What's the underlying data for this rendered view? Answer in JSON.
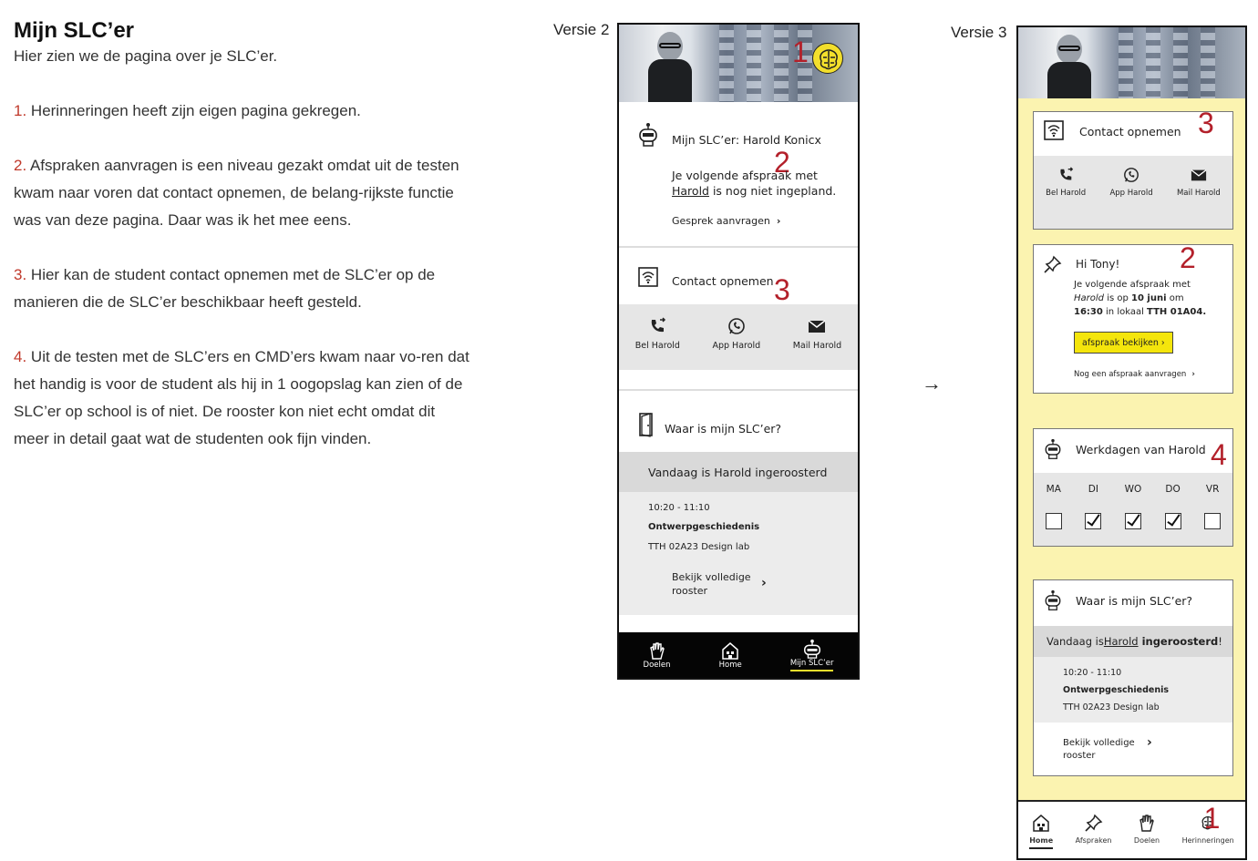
{
  "doc": {
    "title": "Mijn SLC’er",
    "subtitle": "Hier zien we de pagina over je SLC’er.",
    "points": [
      {
        "num": "1.",
        "text": " Herinneringen heeft zijn eigen pagina gekregen."
      },
      {
        "num": "2.",
        "text": " Afspraken aanvragen is een niveau gezakt omdat uit de testen kwam naar voren dat contact opnemen, de belang-rijkste functie was van deze pagina. Daar was ik het mee eens."
      },
      {
        "num": "3.",
        "text": " Hier kan de student contact opnemen met de SLC’er op de manieren die de SLC’er beschikbaar heeft gesteld."
      },
      {
        "num": "4.",
        "text": " Uit de testen met de SLC’ers en CMD’ers kwam naar vo-ren dat het handig is voor de student als hij in 1 oogopslag kan zien of de SLC’er op school is of niet. De rooster kon niet echt omdat dit meer in detail gaat wat de studenten ook fijn vinden."
      }
    ]
  },
  "labels": {
    "versie2": "Versie 2",
    "versie3": "Versie 3",
    "arrow": "→"
  },
  "markers": {
    "one": "1",
    "two": "2",
    "three": "3",
    "four": "4"
  },
  "v2": {
    "slc_title": "Mijn SLC’er: Harold Konicx",
    "next_line1": "Je volgende afspraak met",
    "next_name": "Harold",
    "next_line2": " is nog niet ingepland.",
    "request": "Gesprek aanvragen",
    "contact_title": "Contact opnemen",
    "contact": [
      {
        "label": "Bel Harold",
        "icon": "phone-icon"
      },
      {
        "label": "App Harold",
        "icon": "whatsapp-icon"
      },
      {
        "label": "Mail Harold",
        "icon": "mail-icon"
      }
    ],
    "where_title": "Waar is mijn SLC’er?",
    "today": "Vandaag is Harold ingeroosterd",
    "time": "10:20 - 11:10",
    "course": "Ontwerpgeschiedenis",
    "room": "TTH 02A23 Design lab",
    "full_schedule": "Bekijk volledige rooster",
    "nav": [
      {
        "label": "Doelen",
        "icon": "hand-icon"
      },
      {
        "label": "Home",
        "icon": "home-icon"
      },
      {
        "label": "Mijn SLC’er",
        "icon": "robot-icon"
      }
    ]
  },
  "v3": {
    "contact_title": "Contact opnemen",
    "contact": [
      {
        "label": "Bel Harold",
        "icon": "phone-icon"
      },
      {
        "label": "App Harold",
        "icon": "whatsapp-icon"
      },
      {
        "label": "Mail Harold",
        "icon": "mail-icon"
      }
    ],
    "greeting": "Hi Tony!",
    "appt_a": "Je volgende afspraak met",
    "appt_name": "Harold",
    "appt_b": " is op ",
    "appt_date": "10 juni",
    "appt_c": " om",
    "appt_time": "16:30",
    "appt_d": " in lokaal ",
    "appt_room": "TTH 01A04.",
    "view_appt": "afspraak bekijken ›",
    "request_other": "Nog een afspraak aanvragen",
    "workdays_title": "Werkdagen van Harold",
    "days": [
      "MA",
      "DI",
      "WO",
      "DO",
      "VR"
    ],
    "days_checked": [
      false,
      true,
      true,
      true,
      false
    ],
    "where_title": "Waar is mijn SLC’er?",
    "today_a": "Vandaag is ",
    "today_name": "Harold",
    "today_b": "ingeroosterd",
    "today_c": "!",
    "time": "10:20 - 11:10",
    "course": "Ontwerpgeschiedenis",
    "room": "TTH 02A23 Design lab",
    "full_schedule": "Bekijk volledige rooster",
    "nav": [
      {
        "label": "Home",
        "icon": "home-icon"
      },
      {
        "label": "Afspraken",
        "icon": "pin-icon"
      },
      {
        "label": "Doelen",
        "icon": "hand-icon"
      },
      {
        "label": "Herinneringen",
        "icon": "brain-icon"
      }
    ]
  }
}
